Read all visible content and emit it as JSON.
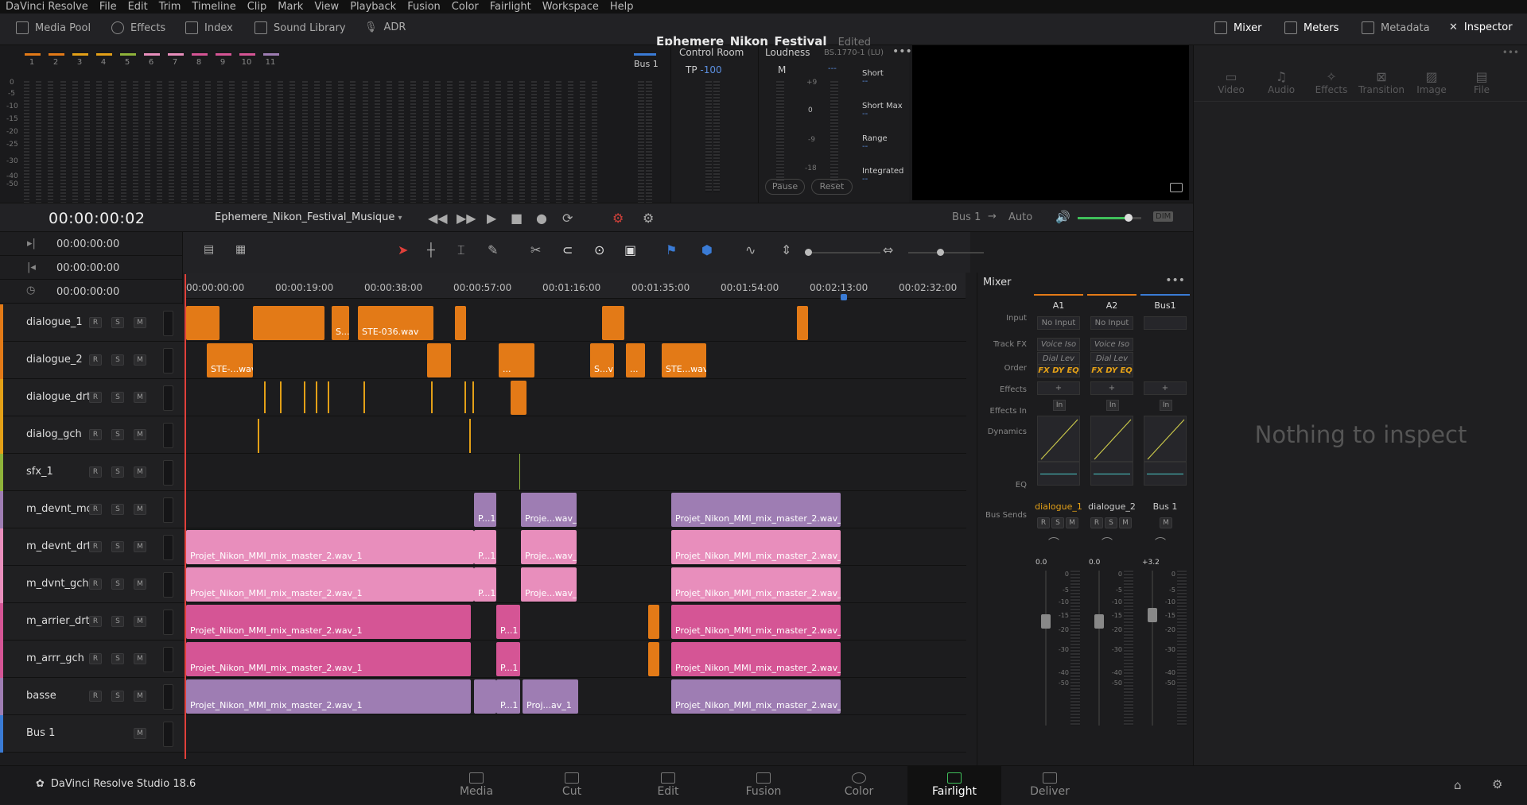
{
  "menu": [
    "DaVinci Resolve",
    "File",
    "Edit",
    "Trim",
    "Timeline",
    "Clip",
    "Mark",
    "View",
    "Playback",
    "Fusion",
    "Color",
    "Fairlight",
    "Workspace",
    "Help"
  ],
  "toolbar": {
    "media_pool": "Media Pool",
    "effects": "Effects",
    "index": "Index",
    "sound_library": "Sound Library",
    "adr": "ADR",
    "mixer": "Mixer",
    "meters": "Meters",
    "metadata": "Metadata",
    "inspector": "Inspector"
  },
  "project": {
    "name": "Ephemere_Nikon_Festival",
    "status": "Edited"
  },
  "meter_channels": [
    "1",
    "2",
    "3",
    "4",
    "5",
    "6",
    "7",
    "8",
    "9",
    "10",
    "11"
  ],
  "meter_channel_colors": [
    "#e37a17",
    "#e37a17",
    "#e3a017",
    "#e3a017",
    "#8fb33a",
    "#e88ebc",
    "#e88ebc",
    "#d55595",
    "#d55595",
    "#d55595",
    "#9e7db3"
  ],
  "meter_scale": [
    "0",
    "-5",
    "-10",
    "-15",
    "-20",
    "-25",
    "-30",
    "-40",
    "-50"
  ],
  "bus_meter": {
    "label": "Bus 1"
  },
  "control_room": {
    "title": "Control Room",
    "tp_label": "TP",
    "tp_value": "-100"
  },
  "loudness": {
    "title": "Loudness",
    "standard": "BS.1770-1 (LU)",
    "m_label": "M",
    "m_value": "---",
    "scale": [
      "+9",
      "0",
      "-9",
      "-18"
    ],
    "short": "Short",
    "short_max": "Short Max",
    "range": "Range",
    "integrated": "Integrated",
    "dash": "--",
    "pause": "Pause",
    "reset": "Reset"
  },
  "transport": {
    "timecode": "00:00:00:02",
    "timeline_name": "Ephemere_Nikon_Festival_Musique",
    "bus": "Bus 1",
    "arrow": "→",
    "auto": "Auto",
    "dim": "DIM",
    "volume": 0.8
  },
  "tc_rows": [
    "00:00:00:00",
    "00:00:00:00",
    "00:00:00:00"
  ],
  "ruler_ticks": [
    "00:00:00:00",
    "00:00:19:00",
    "00:00:38:00",
    "00:00:57:00",
    "00:01:16:00",
    "00:01:35:00",
    "00:01:54:00",
    "00:02:13:00",
    "00:02:32:00"
  ],
  "tracks": [
    {
      "name": "dialogue_1",
      "color": "#e37a17"
    },
    {
      "name": "dialogue_2",
      "color": "#e37a17"
    },
    {
      "name": "dialogue_drt",
      "color": "#e3a017"
    },
    {
      "name": "dialog_gch",
      "color": "#e3a017"
    },
    {
      "name": "sfx_1",
      "color": "#8fb33a"
    },
    {
      "name": "m_devnt_md",
      "color": "#9e7db3"
    },
    {
      "name": "m_devnt_drt",
      "color": "#e88ebc"
    },
    {
      "name": "m_dvnt_gch",
      "color": "#e88ebc"
    },
    {
      "name": "m_arrier_drt",
      "color": "#d55595"
    },
    {
      "name": "m_arrr_gch",
      "color": "#d55595"
    },
    {
      "name": "basse",
      "color": "#9e7db3"
    },
    {
      "name": "Bus 1",
      "color": "#3a7bd5"
    }
  ],
  "track_buttons": {
    "r": "R",
    "s": "S",
    "m": "M"
  },
  "clips": {
    "long": "Projet_Nikon_MMI_mix_master_2.wav_1",
    "p1": "P...1",
    "proje": "Proje...wav_1",
    "proj_av": "Proj...av_1",
    "ste036": "STE-036.wav",
    "ste_wav": "STE-...wav",
    "sv": "S...v",
    "dots": "...",
    "ste_wav2": "STE...wav"
  },
  "mixer": {
    "title": "Mixer",
    "columns": [
      "A1",
      "A2",
      "Bus1"
    ],
    "row_labels": [
      "Input",
      "Track FX",
      "Order",
      "Effects",
      "Effects In",
      "Dynamics",
      "EQ",
      "Bus Sends"
    ],
    "input": "No Input",
    "fx1": "Voice Iso",
    "fx2": "Dial Lev",
    "order": "FX DY EQ",
    "plus": "+",
    "in": "In",
    "names": [
      "dialogue_1",
      "dialogue_2",
      "Bus 1"
    ],
    "gains": [
      "0.0",
      "0.0",
      "+3.2"
    ],
    "scale": [
      "0",
      "-5",
      "-10",
      "-15",
      "-20",
      "-30",
      "-40",
      "-50"
    ]
  },
  "inspector": {
    "tabs": [
      "Video",
      "Audio",
      "Effects",
      "Transition",
      "Image",
      "File"
    ],
    "empty": "Nothing to inspect"
  },
  "bottom": {
    "app": "DaVinci Resolve Studio 18.6",
    "pages": [
      "Media",
      "Cut",
      "Edit",
      "Fusion",
      "Color",
      "Fairlight",
      "Deliver"
    ],
    "active": "Fairlight"
  },
  "colors": {
    "accent_orange": "#e37a17",
    "fader_green": "#3fbf5a"
  }
}
